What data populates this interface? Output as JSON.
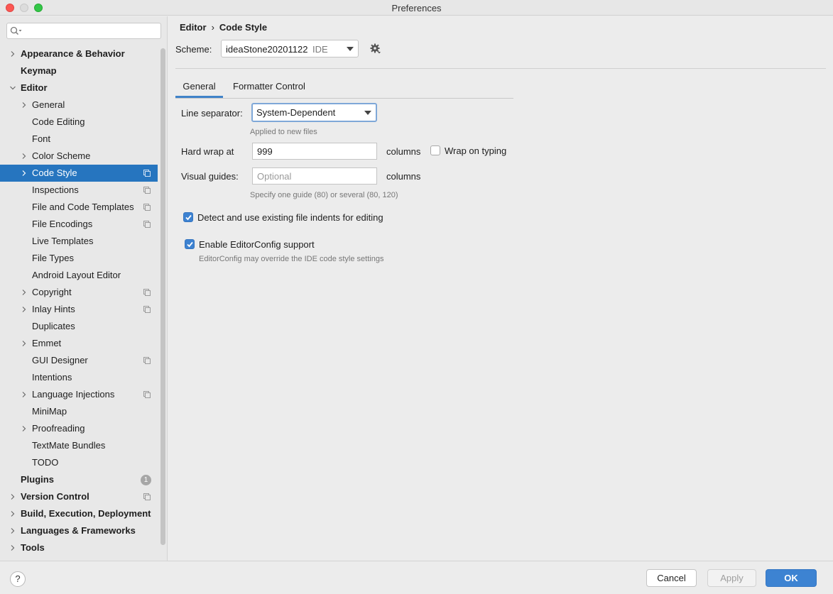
{
  "window": {
    "title": "Preferences"
  },
  "search": {
    "placeholder": "",
    "value": ""
  },
  "sidebar": {
    "items": [
      {
        "label": "Appearance & Behavior",
        "level": 0,
        "bold": true,
        "chevron": "right"
      },
      {
        "label": "Keymap",
        "level": 0,
        "bold": true,
        "chevron": "none"
      },
      {
        "label": "Editor",
        "level": 0,
        "bold": true,
        "chevron": "down"
      },
      {
        "label": "General",
        "level": 1,
        "chevron": "right"
      },
      {
        "label": "Code Editing",
        "level": 1,
        "chevron": "none"
      },
      {
        "label": "Font",
        "level": 1,
        "chevron": "none"
      },
      {
        "label": "Color Scheme",
        "level": 1,
        "chevron": "right"
      },
      {
        "label": "Code Style",
        "level": 1,
        "chevron": "right",
        "selected": true,
        "copy_icon": true
      },
      {
        "label": "Inspections",
        "level": 1,
        "chevron": "none",
        "copy_icon": true
      },
      {
        "label": "File and Code Templates",
        "level": 1,
        "chevron": "none",
        "copy_icon": true
      },
      {
        "label": "File Encodings",
        "level": 1,
        "chevron": "none",
        "copy_icon": true
      },
      {
        "label": "Live Templates",
        "level": 1,
        "chevron": "none"
      },
      {
        "label": "File Types",
        "level": 1,
        "chevron": "none"
      },
      {
        "label": "Android Layout Editor",
        "level": 1,
        "chevron": "none"
      },
      {
        "label": "Copyright",
        "level": 1,
        "chevron": "right",
        "copy_icon": true
      },
      {
        "label": "Inlay Hints",
        "level": 1,
        "chevron": "right",
        "copy_icon": true
      },
      {
        "label": "Duplicates",
        "level": 1,
        "chevron": "none"
      },
      {
        "label": "Emmet",
        "level": 1,
        "chevron": "right"
      },
      {
        "label": "GUI Designer",
        "level": 1,
        "chevron": "none",
        "copy_icon": true
      },
      {
        "label": "Intentions",
        "level": 1,
        "chevron": "none"
      },
      {
        "label": "Language Injections",
        "level": 1,
        "chevron": "right",
        "copy_icon": true
      },
      {
        "label": "MiniMap",
        "level": 1,
        "chevron": "none"
      },
      {
        "label": "Proofreading",
        "level": 1,
        "chevron": "right"
      },
      {
        "label": "TextMate Bundles",
        "level": 1,
        "chevron": "none"
      },
      {
        "label": "TODO",
        "level": 1,
        "chevron": "none"
      },
      {
        "label": "Plugins",
        "level": 0,
        "bold": true,
        "chevron": "none",
        "badge": "1"
      },
      {
        "label": "Version Control",
        "level": 0,
        "bold": true,
        "chevron": "right",
        "copy_icon": true
      },
      {
        "label": "Build, Execution, Deployment",
        "level": 0,
        "bold": true,
        "chevron": "right"
      },
      {
        "label": "Languages & Frameworks",
        "level": 0,
        "bold": true,
        "chevron": "right"
      },
      {
        "label": "Tools",
        "level": 0,
        "bold": true,
        "chevron": "right"
      }
    ]
  },
  "breadcrumb": {
    "parent": "Editor",
    "separator": "›",
    "current": "Code Style"
  },
  "scheme": {
    "label": "Scheme:",
    "value": "ideaStone20201122",
    "tag": "IDE"
  },
  "tabs": [
    {
      "label": "General",
      "active": true
    },
    {
      "label": "Formatter Control"
    }
  ],
  "general": {
    "line_separator_label": "Line separator:",
    "line_separator_value": "System-Dependent",
    "line_separator_hint": "Applied to new files",
    "hard_wrap_label": "Hard wrap at",
    "hard_wrap_value": "999",
    "hard_wrap_unit": "columns",
    "wrap_on_typing_label": "Wrap on typing",
    "wrap_on_typing_checked": false,
    "visual_guides_label": "Visual guides:",
    "visual_guides_placeholder": "Optional",
    "visual_guides_unit": "columns",
    "visual_guides_hint": "Specify one guide (80) or several (80, 120)",
    "detect_indents_label": "Detect and use existing file indents for editing",
    "detect_indents_checked": true,
    "editorconfig_label": "Enable EditorConfig support",
    "editorconfig_checked": true,
    "editorconfig_hint": "EditorConfig may override the IDE code style settings"
  },
  "footer": {
    "help": "?",
    "cancel": "Cancel",
    "apply": "Apply",
    "ok": "OK"
  },
  "colors": {
    "accent": "#2675bf",
    "ok_button": "#3d83d2",
    "checkbox": "#3d82d1"
  }
}
